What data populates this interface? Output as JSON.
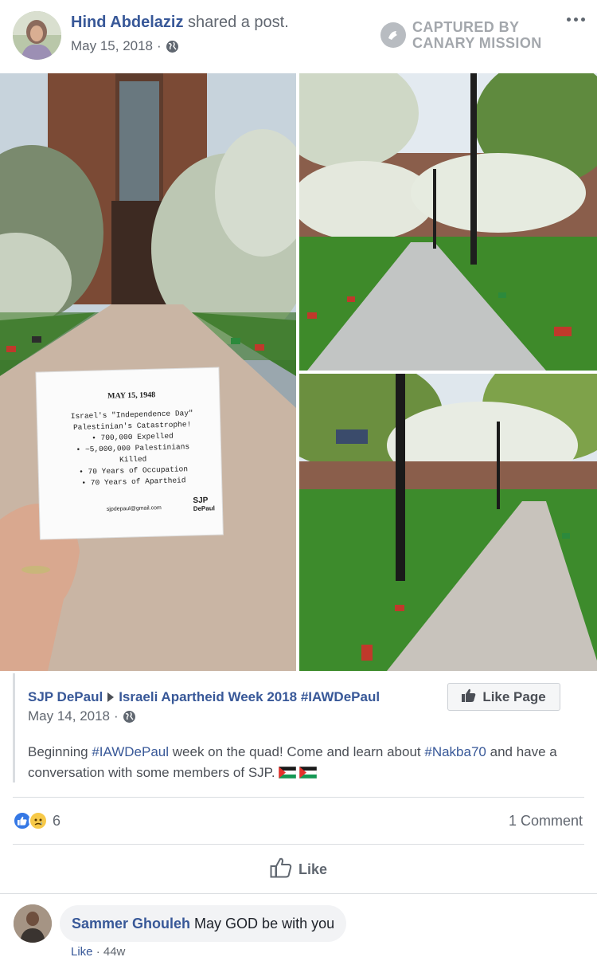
{
  "post": {
    "author": "Hind Abdelaziz",
    "action": "shared a post.",
    "date": "May 15, 2018",
    "separator": "·",
    "watermark_line1": "CAPTURED BY",
    "watermark_line2": "CANARY MISSION"
  },
  "photo_note": {
    "title": "MAY 15, 1948",
    "line1": "Israel's \"Independence Day\"",
    "line2": "Palestinian's Catastrophe!",
    "line3": "• 700,000 Expelled",
    "line4": "• ~5,000,000 Palestinians",
    "line5": "Killed",
    "line6": "• 70 Years of Occupation",
    "line7": "• 70 Years of Apartheid",
    "email": "sjpdepaul@gmail.com",
    "logo_line1": "SJP",
    "logo_line2": "DePaul"
  },
  "shared": {
    "page_name": "SJP DePaul",
    "event_name": "Israeli Apartheid Week 2018 #IAWDePaul",
    "date": "May 14, 2018",
    "separator": "·",
    "like_page_label": "Like Page",
    "body_part1": "Beginning ",
    "hashtag1": "#IAWDePaul",
    "body_part2": " week on the quad! Come and learn about ",
    "hashtag2": "#Nakba70",
    "body_part3": " and have a conversation with some members of SJP."
  },
  "reactions": {
    "count": "6",
    "comments": "1 Comment"
  },
  "actions": {
    "like_label": "Like"
  },
  "comment": {
    "author": "Sammer Ghouleh",
    "text": "May GOD be with you",
    "like_label": "Like",
    "separator": "·",
    "time": "44w"
  },
  "colors": {
    "link": "#385898",
    "muted": "#616770",
    "like_blue": "#3578e5"
  }
}
